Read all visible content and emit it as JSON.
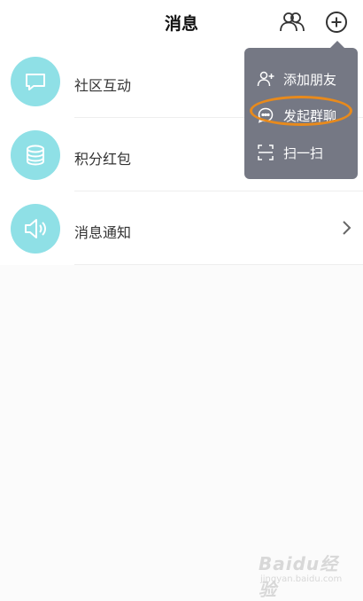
{
  "header": {
    "title": "消息",
    "contacts_icon": "contacts-icon",
    "add_icon": "plus-circle-icon"
  },
  "list": {
    "items": [
      {
        "label": "社区互动",
        "icon": "chat-bubble-icon"
      },
      {
        "label": "积分红包",
        "icon": "coin-stack-icon"
      },
      {
        "label": "消息通知",
        "icon": "speaker-icon",
        "has_chevron": true
      }
    ]
  },
  "menu": {
    "items": [
      {
        "label": "添加朋友",
        "icon": "add-friend-icon"
      },
      {
        "label": "发起群聊",
        "icon": "group-chat-icon",
        "highlighted": true
      },
      {
        "label": "扫一扫",
        "icon": "scan-icon"
      }
    ]
  },
  "colors": {
    "icon_circle": "#8fe0e6",
    "menu_bg": "#757884",
    "highlight": "#e88a1c"
  },
  "watermark": {
    "main": "Baidu经验",
    "sub": "jingyan.baidu.com"
  }
}
